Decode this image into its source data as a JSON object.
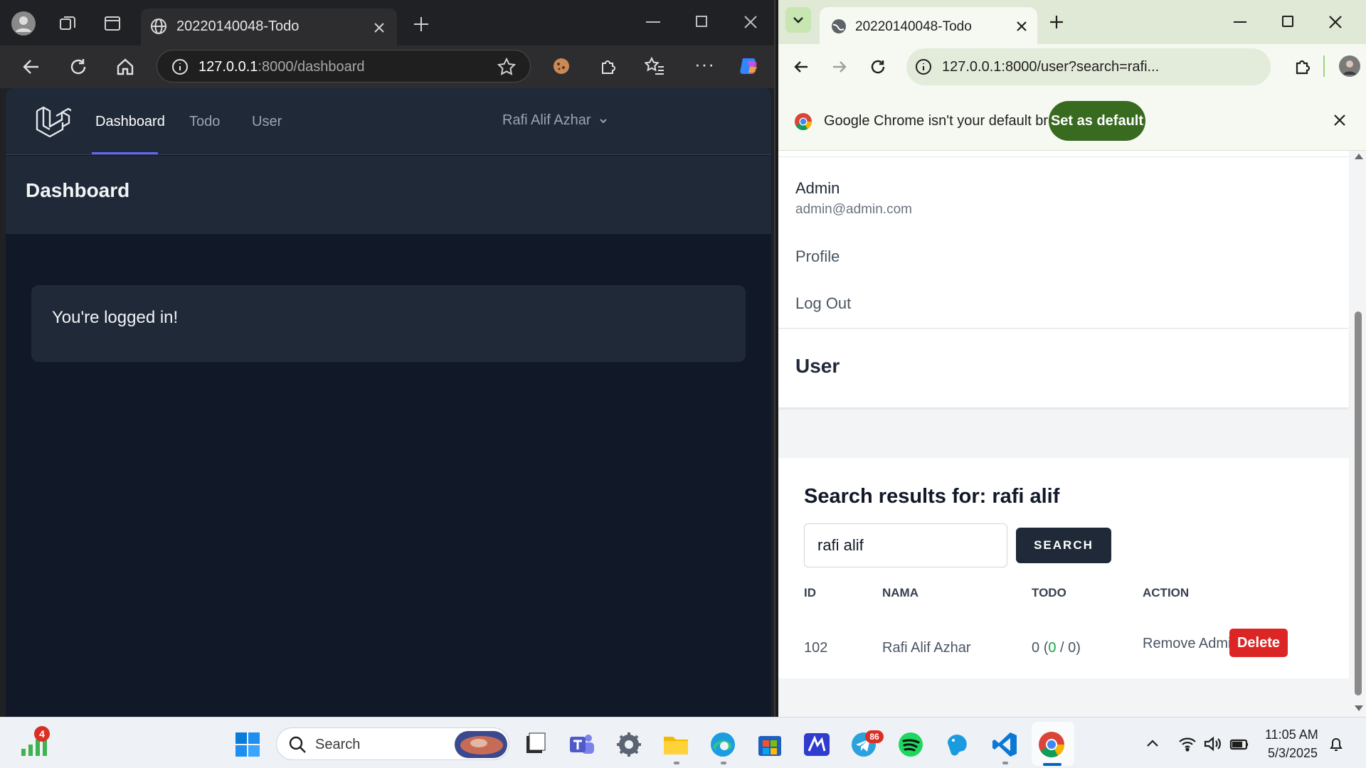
{
  "edge": {
    "tab_title": "20220140048-Todo",
    "url_host": "127.0.0.1",
    "url_rest": ":8000/dashboard"
  },
  "laravel": {
    "nav": [
      {
        "label": "Dashboard",
        "active": true
      },
      {
        "label": "Todo",
        "active": false
      },
      {
        "label": "User",
        "active": false
      }
    ],
    "user_menu": "Rafi Alif Azhar",
    "page_header": "Dashboard",
    "card_text": "You're logged in!",
    "accent": "#6366f1"
  },
  "chrome": {
    "tab_title": "20220140048-Todo",
    "url": "127.0.0.1:8000/user?search=rafi...",
    "infobar_text": "Google Chrome isn't your default browser",
    "set_default_label": "Set as default",
    "dropdown": {
      "name": "Admin",
      "email": "admin@admin.com",
      "links": [
        "Profile",
        "Log Out"
      ]
    },
    "page_header": "User",
    "search_heading": "Search results for: rafi alif",
    "search_value": "rafi alif",
    "search_button": "SEARCH",
    "table": {
      "headers": [
        "ID",
        "NAMA",
        "TODO",
        "ACTION"
      ],
      "rows": [
        {
          "id": "102",
          "nama": "Rafi Alif Azhar",
          "todo_total": "0",
          "todo_open": "(",
          "todo_done": "0",
          "todo_close": "/ 0)",
          "action_remove": "Remove Admin",
          "action_delete": "Delete"
        }
      ]
    }
  },
  "taskbar": {
    "search_placeholder": "Search",
    "time": "11:05 AM",
    "date": "5/3/2025",
    "notification_badge": "4",
    "telegram_badge": "86"
  }
}
